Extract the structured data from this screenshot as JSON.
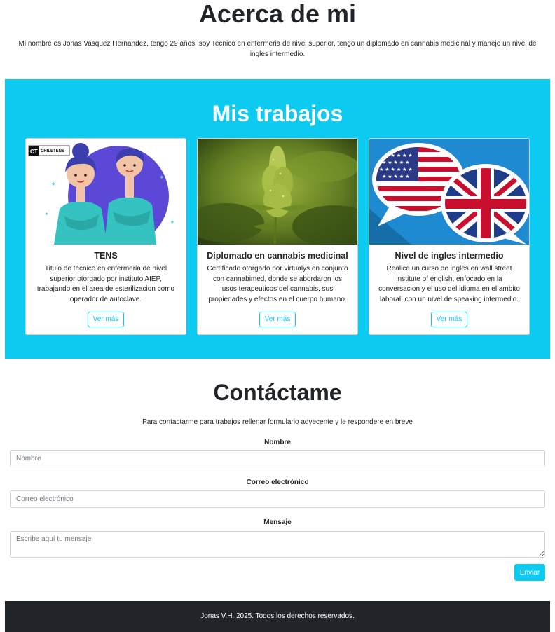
{
  "about": {
    "title": "Acerca de mi",
    "text": "Mi nombre es Jonas Vasquez Hernandez, tengo 29 años, soy Tecnico en enfermeria de nivel superior, tengo un diplomado en cannabis medicinal y manejo un nivel de ingles intermedio."
  },
  "works": {
    "title": "Mis trabajos",
    "cards": [
      {
        "title": "TENS",
        "text": "Titulo de tecnico en enfermeria de nivel superior otorgado por instituto AIEP, trabajando en el area de esterilizacion como operador de autoclave.",
        "button": "Ver más",
        "logo": "CT CHILETENS"
      },
      {
        "title": "Diplomado en cannabis medicinal",
        "text": "Certificado otorgado por virtualys en conjunto con cannabimed, donde se abordaron los usos terapeuticos del cannabis, sus propiedades y efectos en el cuerpo humano.",
        "button": "Ver más"
      },
      {
        "title": "Nivel de ingles intermedio",
        "text": "Realice un curso de ingles en wall street institute of english, enfocado en la conversacion y el uso del idioma en el ambito laboral, con un nivel de speaking intermedio.",
        "button": "Ver más"
      }
    ]
  },
  "contact": {
    "title": "Contáctame",
    "lead": "Para contactarme para trabajos rellenar formulario adyecente y le respondere en breve",
    "name_label": "Nombre",
    "name_placeholder": "Nombre",
    "email_label": "Correo electrónico",
    "email_placeholder": "Correo electrónico",
    "message_label": "Mensaje",
    "message_placeholder": "Escribe aquí tu mensaje",
    "submit": "Enviar"
  },
  "footer": {
    "text": "Jonas V.H. 2025. Todos los derechos reservados."
  },
  "colors": {
    "accent": "#0dcaf0",
    "footer_bg": "#212529"
  }
}
